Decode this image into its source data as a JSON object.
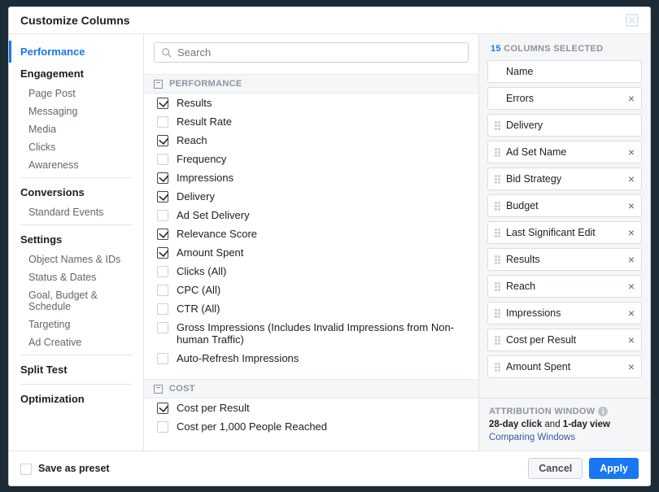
{
  "dialog": {
    "title": "Customize Columns",
    "close_label": "Close"
  },
  "search": {
    "placeholder": "Search"
  },
  "sidebar": {
    "categories": [
      {
        "label": "Performance",
        "active": true,
        "subs": []
      },
      {
        "label": "Engagement",
        "subs": [
          "Page Post",
          "Messaging",
          "Media",
          "Clicks",
          "Awareness"
        ],
        "divider": true
      },
      {
        "label": "Conversions",
        "subs": [
          "Standard Events"
        ],
        "divider": true
      },
      {
        "label": "Settings",
        "subs": [
          "Object Names & IDs",
          "Status & Dates",
          "Goal, Budget & Schedule",
          "Targeting",
          "Ad Creative"
        ],
        "divider": true
      },
      {
        "label": "Split Test",
        "subs": [],
        "divider": true
      },
      {
        "label": "Optimization",
        "subs": []
      }
    ]
  },
  "sections": [
    {
      "title": "PERFORMANCE",
      "metrics": [
        {
          "label": "Results",
          "checked": true
        },
        {
          "label": "Result Rate",
          "checked": false
        },
        {
          "label": "Reach",
          "checked": true
        },
        {
          "label": "Frequency",
          "checked": false
        },
        {
          "label": "Impressions",
          "checked": true
        },
        {
          "label": "Delivery",
          "checked": true
        },
        {
          "label": "Ad Set Delivery",
          "checked": false
        },
        {
          "label": "Relevance Score",
          "checked": true
        },
        {
          "label": "Amount Spent",
          "checked": true
        },
        {
          "label": "Clicks (All)",
          "checked": false
        },
        {
          "label": "CPC (All)",
          "checked": false
        },
        {
          "label": "CTR (All)",
          "checked": false
        },
        {
          "label": "Gross Impressions (Includes Invalid Impressions from Non-human Traffic)",
          "checked": false
        },
        {
          "label": "Auto-Refresh Impressions",
          "checked": false
        }
      ]
    },
    {
      "title": "COST",
      "metrics": [
        {
          "label": "Cost per Result",
          "checked": true
        },
        {
          "label": "Cost per 1,000 People Reached",
          "checked": false
        }
      ]
    }
  ],
  "selected": {
    "count": "15",
    "label_suffix": " COLUMNS SELECTED",
    "items": [
      {
        "label": "Name",
        "removable": false,
        "draggable": false
      },
      {
        "label": "Errors",
        "removable": true,
        "draggable": false
      },
      {
        "label": "Delivery",
        "removable": false,
        "draggable": true
      },
      {
        "label": "Ad Set Name",
        "removable": true,
        "draggable": true
      },
      {
        "label": "Bid Strategy",
        "removable": true,
        "draggable": true
      },
      {
        "label": "Budget",
        "removable": true,
        "draggable": true
      },
      {
        "label": "Last Significant Edit",
        "removable": true,
        "draggable": true
      },
      {
        "label": "Results",
        "removable": true,
        "draggable": true
      },
      {
        "label": "Reach",
        "removable": true,
        "draggable": true
      },
      {
        "label": "Impressions",
        "removable": true,
        "draggable": true
      },
      {
        "label": "Cost per Result",
        "removable": true,
        "draggable": true
      },
      {
        "label": "Amount Spent",
        "removable": true,
        "draggable": true
      }
    ]
  },
  "attribution": {
    "title": "ATTRIBUTION WINDOW",
    "text_prefix": "28-day click",
    "text_mid": " and ",
    "text_suffix": "1-day view",
    "link": "Comparing Windows"
  },
  "footer": {
    "save_preset": "Save as preset",
    "cancel": "Cancel",
    "apply": "Apply"
  }
}
